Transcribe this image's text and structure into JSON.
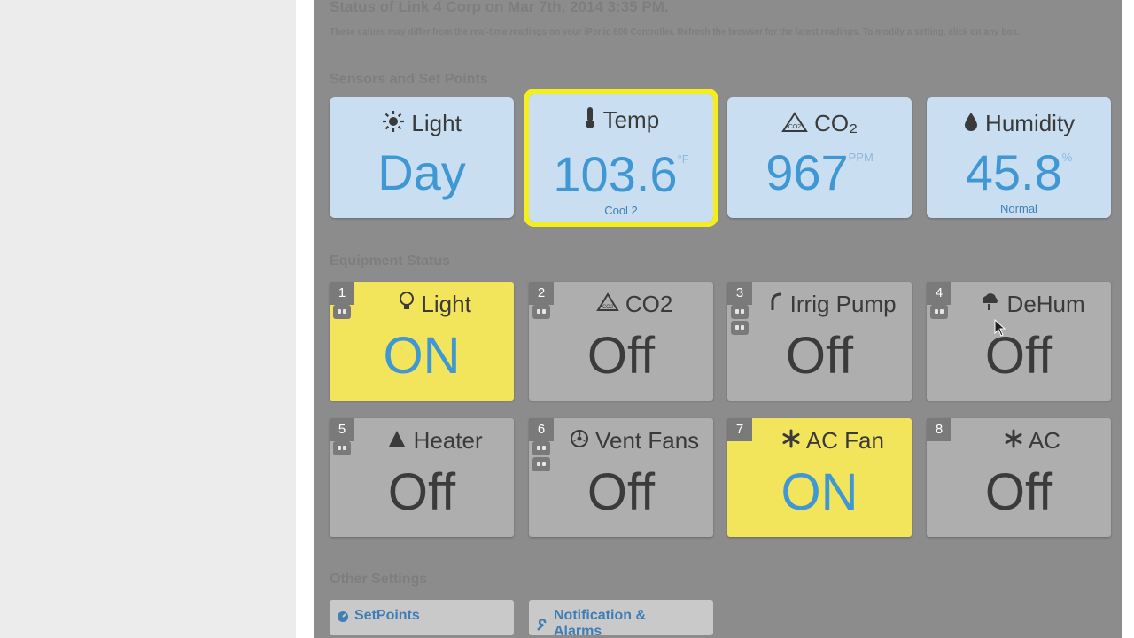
{
  "header": {
    "status_title": "Status of Link 4 Corp on Mar 7th, 2014 3:35 PM.",
    "note": "These values may differ from the real-time readings on your iPonic 600 Controller. Refresh the browser for the latest readings. To modify a setting, click on any box."
  },
  "sections": {
    "sensors": "Sensors and Set Points",
    "equipment": "Equipment Status",
    "other": "Other Settings"
  },
  "sensors": [
    {
      "label": "Light",
      "icon": "sun-icon",
      "value": "Day",
      "unit": "",
      "sub": ""
    },
    {
      "label": "Temp",
      "icon": "thermometer-icon",
      "value": "103.6",
      "unit": "°F",
      "sub": "Cool 2"
    },
    {
      "label": "CO₂",
      "icon": "co2-icon",
      "value": "967",
      "unit": "PPM",
      "sub": ""
    },
    {
      "label": "Humidity",
      "icon": "droplet-icon",
      "value": "45.8",
      "unit": "%",
      "sub": "Normal"
    }
  ],
  "equipment": [
    {
      "num": "1",
      "name": "Light",
      "icon": "bulb-icon",
      "state": "ON"
    },
    {
      "num": "2",
      "name": "CO2",
      "icon": "co2-icon",
      "state": "Off"
    },
    {
      "num": "3",
      "name": "Irrig Pump",
      "icon": "pump-icon",
      "state": "Off"
    },
    {
      "num": "4",
      "name": "DeHum",
      "icon": "cloud-icon",
      "state": "Off"
    },
    {
      "num": "5",
      "name": "Heater",
      "icon": "flame-icon",
      "state": "Off"
    },
    {
      "num": "6",
      "name": "Vent Fans",
      "icon": "fan-icon",
      "state": "Off"
    },
    {
      "num": "7",
      "name": "AC Fan",
      "icon": "snowflake-icon",
      "state": "ON"
    },
    {
      "num": "8",
      "name": "AC",
      "icon": "snowflake-icon",
      "state": "Off"
    }
  ],
  "other_settings": [
    {
      "label": "SetPoints",
      "icon": "gauge-icon"
    },
    {
      "label": "Notification & Alarms",
      "icon": "wrench-icon"
    }
  ],
  "colors": {
    "on_background": "#f3e55b",
    "off_background": "#aeaeae",
    "sensor_background": "#c9def0",
    "value_blue": "#3f97d4",
    "highlight_outline": "#f5ee1f"
  }
}
